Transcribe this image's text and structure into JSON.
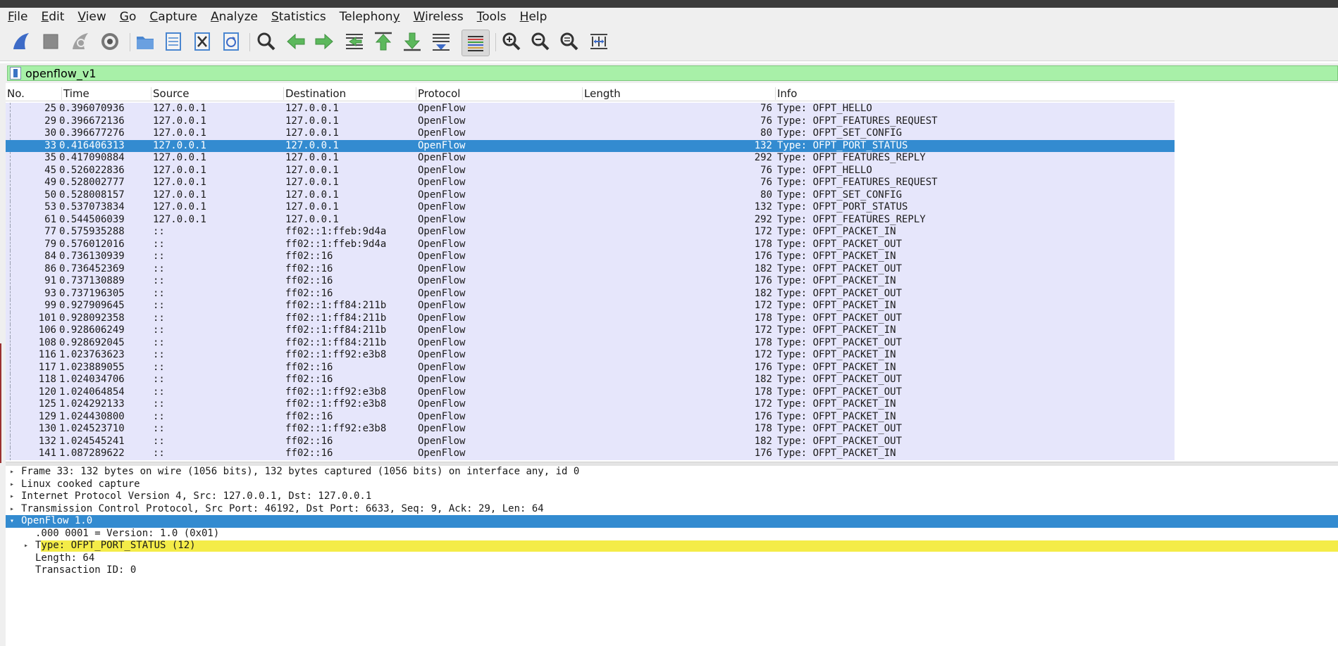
{
  "menubar": [
    {
      "mnemonic": "F",
      "rest": "ile"
    },
    {
      "mnemonic": "E",
      "rest": "dit"
    },
    {
      "mnemonic": "V",
      "rest": "iew"
    },
    {
      "mnemonic": "G",
      "rest": "o"
    },
    {
      "mnemonic": "C",
      "rest": "apture"
    },
    {
      "mnemonic": "A",
      "rest": "nalyze"
    },
    {
      "mnemonic": "S",
      "rest": "tatistics"
    },
    {
      "mnemonic": "",
      "rest": "Telephon",
      "mnemonic_end": "y"
    },
    {
      "mnemonic": "W",
      "rest": "ireless"
    },
    {
      "mnemonic": "T",
      "rest": "ools"
    },
    {
      "mnemonic": "H",
      "rest": "elp"
    }
  ],
  "toolbar_icons": [
    "shark-start-icon",
    "stop-icon",
    "restart-icon",
    "capture-options-icon",
    "open-folder-icon",
    "save-file-icon",
    "close-file-icon",
    "reload-icon",
    "find-icon",
    "go-back-icon",
    "go-forward-icon",
    "go-to-packet-icon",
    "first-packet-icon",
    "last-packet-icon",
    "autoscroll-icon",
    "colorize-icon",
    "zoom-in-icon",
    "zoom-out-icon",
    "zoom-reset-icon",
    "resize-columns-icon"
  ],
  "filter": {
    "value": "openflow_v1"
  },
  "columns": [
    "No.",
    "Time",
    "Source",
    "Destination",
    "Protocol",
    "Length",
    "Info"
  ],
  "packets": [
    {
      "no": "25",
      "time": "0.396070936",
      "src": "127.0.0.1",
      "dst": "127.0.0.1",
      "proto": "OpenFlow",
      "len": "76",
      "info": "Type: OFPT_HELLO"
    },
    {
      "no": "29",
      "time": "0.396672136",
      "src": "127.0.0.1",
      "dst": "127.0.0.1",
      "proto": "OpenFlow",
      "len": "76",
      "info": "Type: OFPT_FEATURES_REQUEST"
    },
    {
      "no": "30",
      "time": "0.396677276",
      "src": "127.0.0.1",
      "dst": "127.0.0.1",
      "proto": "OpenFlow",
      "len": "80",
      "info": "Type: OFPT_SET_CONFIG"
    },
    {
      "no": "33",
      "time": "0.416406313",
      "src": "127.0.0.1",
      "dst": "127.0.0.1",
      "proto": "OpenFlow",
      "len": "132",
      "info": "Type: OFPT_PORT_STATUS",
      "selected": true
    },
    {
      "no": "35",
      "time": "0.417090884",
      "src": "127.0.0.1",
      "dst": "127.0.0.1",
      "proto": "OpenFlow",
      "len": "292",
      "info": "Type: OFPT_FEATURES_REPLY"
    },
    {
      "no": "45",
      "time": "0.526022836",
      "src": "127.0.0.1",
      "dst": "127.0.0.1",
      "proto": "OpenFlow",
      "len": "76",
      "info": "Type: OFPT_HELLO"
    },
    {
      "no": "49",
      "time": "0.528002777",
      "src": "127.0.0.1",
      "dst": "127.0.0.1",
      "proto": "OpenFlow",
      "len": "76",
      "info": "Type: OFPT_FEATURES_REQUEST"
    },
    {
      "no": "50",
      "time": "0.528008157",
      "src": "127.0.0.1",
      "dst": "127.0.0.1",
      "proto": "OpenFlow",
      "len": "80",
      "info": "Type: OFPT_SET_CONFIG"
    },
    {
      "no": "53",
      "time": "0.537073834",
      "src": "127.0.0.1",
      "dst": "127.0.0.1",
      "proto": "OpenFlow",
      "len": "132",
      "info": "Type: OFPT_PORT_STATUS"
    },
    {
      "no": "61",
      "time": "0.544506039",
      "src": "127.0.0.1",
      "dst": "127.0.0.1",
      "proto": "OpenFlow",
      "len": "292",
      "info": "Type: OFPT_FEATURES_REPLY"
    },
    {
      "no": "77",
      "time": "0.575935288",
      "src": "::",
      "dst": "ff02::1:ffeb:9d4a",
      "proto": "OpenFlow",
      "len": "172",
      "info": "Type: OFPT_PACKET_IN"
    },
    {
      "no": "79",
      "time": "0.576012016",
      "src": "::",
      "dst": "ff02::1:ffeb:9d4a",
      "proto": "OpenFlow",
      "len": "178",
      "info": "Type: OFPT_PACKET_OUT"
    },
    {
      "no": "84",
      "time": "0.736130939",
      "src": "::",
      "dst": "ff02::16",
      "proto": "OpenFlow",
      "len": "176",
      "info": "Type: OFPT_PACKET_IN"
    },
    {
      "no": "86",
      "time": "0.736452369",
      "src": "::",
      "dst": "ff02::16",
      "proto": "OpenFlow",
      "len": "182",
      "info": "Type: OFPT_PACKET_OUT"
    },
    {
      "no": "91",
      "time": "0.737130889",
      "src": "::",
      "dst": "ff02::16",
      "proto": "OpenFlow",
      "len": "176",
      "info": "Type: OFPT_PACKET_IN"
    },
    {
      "no": "93",
      "time": "0.737196305",
      "src": "::",
      "dst": "ff02::16",
      "proto": "OpenFlow",
      "len": "182",
      "info": "Type: OFPT_PACKET_OUT"
    },
    {
      "no": "99",
      "time": "0.927909645",
      "src": "::",
      "dst": "ff02::1:ff84:211b",
      "proto": "OpenFlow",
      "len": "172",
      "info": "Type: OFPT_PACKET_IN"
    },
    {
      "no": "101",
      "time": "0.928092358",
      "src": "::",
      "dst": "ff02::1:ff84:211b",
      "proto": "OpenFlow",
      "len": "178",
      "info": "Type: OFPT_PACKET_OUT"
    },
    {
      "no": "106",
      "time": "0.928606249",
      "src": "::",
      "dst": "ff02::1:ff84:211b",
      "proto": "OpenFlow",
      "len": "172",
      "info": "Type: OFPT_PACKET_IN"
    },
    {
      "no": "108",
      "time": "0.928692045",
      "src": "::",
      "dst": "ff02::1:ff84:211b",
      "proto": "OpenFlow",
      "len": "178",
      "info": "Type: OFPT_PACKET_OUT"
    },
    {
      "no": "116",
      "time": "1.023763623",
      "src": "::",
      "dst": "ff02::1:ff92:e3b8",
      "proto": "OpenFlow",
      "len": "172",
      "info": "Type: OFPT_PACKET_IN"
    },
    {
      "no": "117",
      "time": "1.023889055",
      "src": "::",
      "dst": "ff02::16",
      "proto": "OpenFlow",
      "len": "176",
      "info": "Type: OFPT_PACKET_IN"
    },
    {
      "no": "118",
      "time": "1.024034706",
      "src": "::",
      "dst": "ff02::16",
      "proto": "OpenFlow",
      "len": "182",
      "info": "Type: OFPT_PACKET_OUT"
    },
    {
      "no": "120",
      "time": "1.024064854",
      "src": "::",
      "dst": "ff02::1:ff92:e3b8",
      "proto": "OpenFlow",
      "len": "178",
      "info": "Type: OFPT_PACKET_OUT"
    },
    {
      "no": "125",
      "time": "1.024292133",
      "src": "::",
      "dst": "ff02::1:ff92:e3b8",
      "proto": "OpenFlow",
      "len": "172",
      "info": "Type: OFPT_PACKET_IN"
    },
    {
      "no": "129",
      "time": "1.024430800",
      "src": "::",
      "dst": "ff02::16",
      "proto": "OpenFlow",
      "len": "176",
      "info": "Type: OFPT_PACKET_IN"
    },
    {
      "no": "130",
      "time": "1.024523710",
      "src": "::",
      "dst": "ff02::1:ff92:e3b8",
      "proto": "OpenFlow",
      "len": "178",
      "info": "Type: OFPT_PACKET_OUT"
    },
    {
      "no": "132",
      "time": "1.024545241",
      "src": "::",
      "dst": "ff02::16",
      "proto": "OpenFlow",
      "len": "182",
      "info": "Type: OFPT_PACKET_OUT"
    },
    {
      "no": "141",
      "time": "1.087289622",
      "src": "::",
      "dst": "ff02::16",
      "proto": "OpenFlow",
      "len": "176",
      "info": "Type: OFPT_PACKET_IN"
    }
  ],
  "details": [
    {
      "text": "Frame 33: 132 bytes on wire (1056 bits), 132 bytes captured (1056 bits) on interface any, id 0",
      "level": 0,
      "arrow": "collapsed"
    },
    {
      "text": "Linux cooked capture",
      "level": 0,
      "arrow": "collapsed"
    },
    {
      "text": "Internet Protocol Version 4, Src: 127.0.0.1, Dst: 127.0.0.1",
      "level": 0,
      "arrow": "collapsed"
    },
    {
      "text": "Transmission Control Protocol, Src Port: 46192, Dst Port: 6633, Seq: 9, Ack: 29, Len: 64",
      "level": 0,
      "arrow": "collapsed"
    },
    {
      "text": "OpenFlow 1.0",
      "level": 0,
      "arrow": "expanded",
      "selected": true
    },
    {
      "text": ".000 0001 = Version: 1.0 (0x01)",
      "level": 1,
      "arrow": "none"
    },
    {
      "text": "Type: OFPT_PORT_STATUS (12)",
      "level": 1,
      "arrow": "collapsed",
      "highlight": true
    },
    {
      "text": "Length: 64",
      "level": 1,
      "arrow": "none"
    },
    {
      "text": "Transaction ID: 0",
      "level": 1,
      "arrow": "none"
    }
  ],
  "colors": {
    "selection": "#338bd0",
    "packet_bg": "#e6e6fb",
    "filter_ok": "#a8f0a8",
    "highlight": "#f4ec48"
  }
}
